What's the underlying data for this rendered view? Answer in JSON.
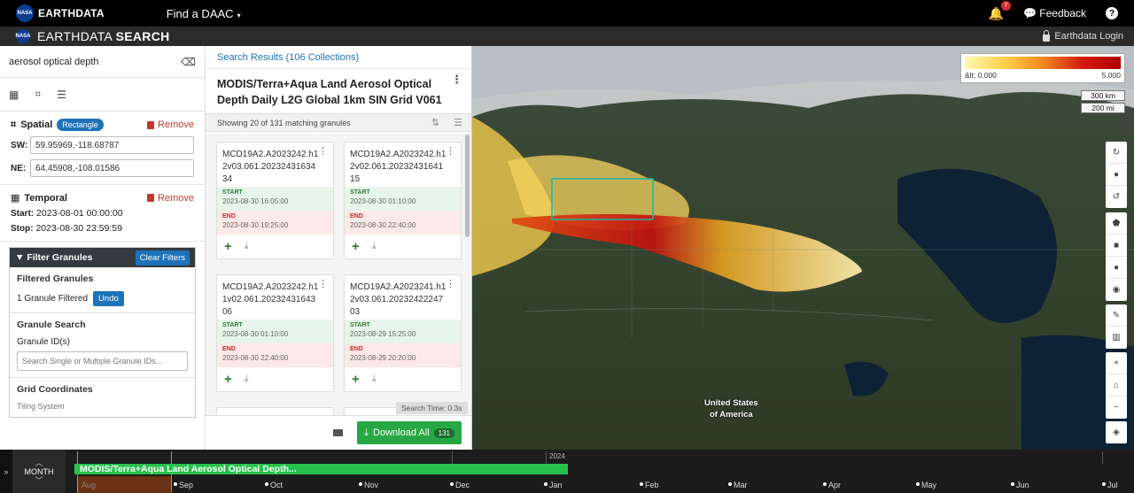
{
  "topbar": {
    "brand": "EARTHDATA",
    "nasa_text": "NASA",
    "find_daac": "Find a DAAC",
    "notification_count": "7",
    "feedback": "Feedback",
    "help": "?"
  },
  "subbar": {
    "title_light": "EARTHDATA",
    "title_bold": "SEARCH",
    "login": "Earthdata Login"
  },
  "search": {
    "value": "aerosol optical depth"
  },
  "spatial": {
    "heading": "Spatial",
    "type": "Rectangle",
    "remove": "Remove",
    "sw_label": "SW:",
    "sw_value": "59.95969,-118.68787",
    "ne_label": "NE:",
    "ne_value": "64.45908,-108.01586"
  },
  "temporal": {
    "heading": "Temporal",
    "remove": "Remove",
    "start_label": "Start:",
    "start_value": "2023-08-01 00:00:00",
    "stop_label": "Stop:",
    "stop_value": "2023-08-30 23:59:59"
  },
  "filter": {
    "heading": "Filter Granules",
    "clear": "Clear Filters",
    "filtered_heading": "Filtered Granules",
    "filtered_text": "1 Granule Filtered",
    "undo": "Undo",
    "granule_search_heading": "Granule Search",
    "granule_ids_label": "Granule ID(s)",
    "granule_ids_placeholder": "Search Single or Multiple Granule IDs...",
    "grid_heading": "Grid Coordinates",
    "tiling_label": "Tiling System"
  },
  "results": {
    "tab": "Search Results (106 Collections)",
    "collection_title": "MODIS/Terra+Aqua Land Aerosol Optical Depth Daily L2G Global 1km SIN Grid V061",
    "showing": "Showing 20 of 131 matching granules",
    "start_label": "START",
    "end_label": "END",
    "granules": [
      {
        "name": "MCD19A2.A2023242.h12v03.061.2023243163434",
        "start": "2023-08-30 16:05:00",
        "end": "2023-08-30 19:25:00"
      },
      {
        "name": "MCD19A2.A2023242.h12v02.061.2023243164115",
        "start": "2023-08-30 01:10:00",
        "end": "2023-08-30 22:40:00"
      },
      {
        "name": "MCD19A2.A2023242.h11v02.061.2023243164306",
        "start": "2023-08-30 01:10:00",
        "end": "2023-08-30 22:40:00"
      },
      {
        "name": "MCD19A2.A2023241.h12v03.061.2023242224703",
        "start": "2023-08-29 15:25:00",
        "end": "2023-08-29 20:20:00"
      }
    ],
    "search_time": "Search Time: 0.3s",
    "download_all": "Download All",
    "download_count": "131"
  },
  "map": {
    "legend_min": "&lt; 0.000",
    "legend_max": "5.000",
    "scale_km": "300 km",
    "scale_mi": "200 mi",
    "place_label_line1": "United States",
    "place_label_line2": "of America"
  },
  "timeline": {
    "zoom_label": "MONTH",
    "bar_label": "MODIS/Terra+Aqua Land Aerosol Optical Depth...",
    "year_label": "2024",
    "months": [
      "Aug",
      "Sep",
      "Oct",
      "Nov",
      "Dec",
      "Jan",
      "Feb",
      "Mar",
      "Apr",
      "May",
      "Jun",
      "Jul"
    ]
  },
  "colors": {
    "accent": "#1d72b8",
    "download": "#27a844",
    "remove": "#c0392b",
    "timeline_bar": "#27c24c"
  }
}
